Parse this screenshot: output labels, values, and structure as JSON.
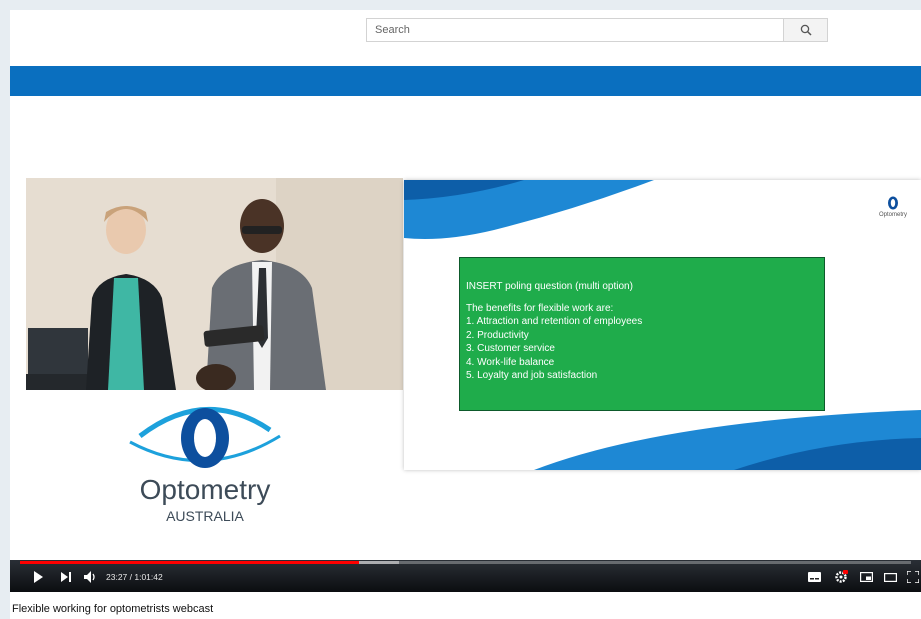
{
  "search": {
    "placeholder": "Search"
  },
  "player": {
    "slide": {
      "lines": [
        "INSERT poling question (multi option)",
        "",
        "The benefits for flexible work are:",
        "1.   Attraction and retention of employees",
        "2.   Productivity",
        "3.   Customer service",
        "4.   Work-life balance",
        "5.   Loyalty and job satisfaction"
      ],
      "logo_text": "Optometry"
    },
    "logo": {
      "name": "Optometry",
      "sub": "AUSTRALIA"
    },
    "controls": {
      "time": "23:27 / 1:01:42",
      "progress": 0.38
    }
  },
  "video": {
    "title": "Flexible working for optometrists webcast"
  },
  "colors": {
    "accent": "#0a6fbf",
    "progress": "#ff0000",
    "slide_box": "#1fac4b"
  }
}
